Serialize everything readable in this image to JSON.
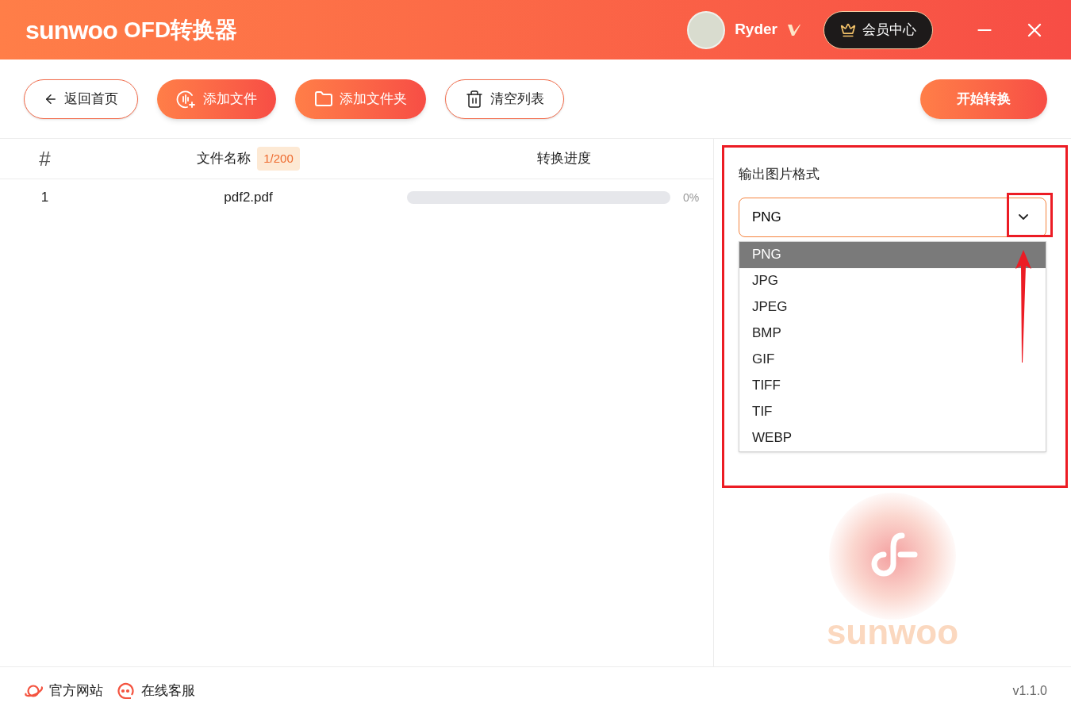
{
  "header": {
    "brand": "sunwoo",
    "title": "OFD转换器",
    "user": "Ryder",
    "member_button": "会员中心"
  },
  "toolbar": {
    "buttons": [
      {
        "label": "返回首页",
        "kind": "back"
      },
      {
        "label": "添加文件",
        "kind": "add-file"
      },
      {
        "label": "添加文件夹",
        "kind": "add-folder"
      },
      {
        "label": "清空列表",
        "kind": "clear"
      }
    ],
    "start_button": "开始转换"
  },
  "table": {
    "columns": [
      "#",
      "文件名称",
      "转换进度"
    ],
    "count_badge": "1/200",
    "rows": [
      {
        "index": "1",
        "name": "pdf2.pdf",
        "level": 0,
        "reading": "0%"
      }
    ]
  },
  "settings": {
    "label": "输出图片格式",
    "select": {
      "value": "PNG",
      "expanded": true
    },
    "options": [
      {
        "label": "PNG",
        "selected": true
      },
      {
        "label": "JPG",
        "selected": false
      },
      {
        "label": "JPEG",
        "selected": false
      },
      {
        "label": "BMP",
        "selected": false
      },
      {
        "label": "GIF",
        "selected": false
      },
      {
        "label": "TIFF",
        "selected": false
      },
      {
        "label": "TIF",
        "selected": false
      },
      {
        "label": "WEBP",
        "selected": false
      }
    ],
    "logo_text": "sunwoo"
  },
  "footer": {
    "links": [
      {
        "label": "官方网站",
        "kind": "web"
      },
      {
        "label": "在线客服",
        "kind": "chat"
      }
    ],
    "version": "v1.1.0"
  }
}
